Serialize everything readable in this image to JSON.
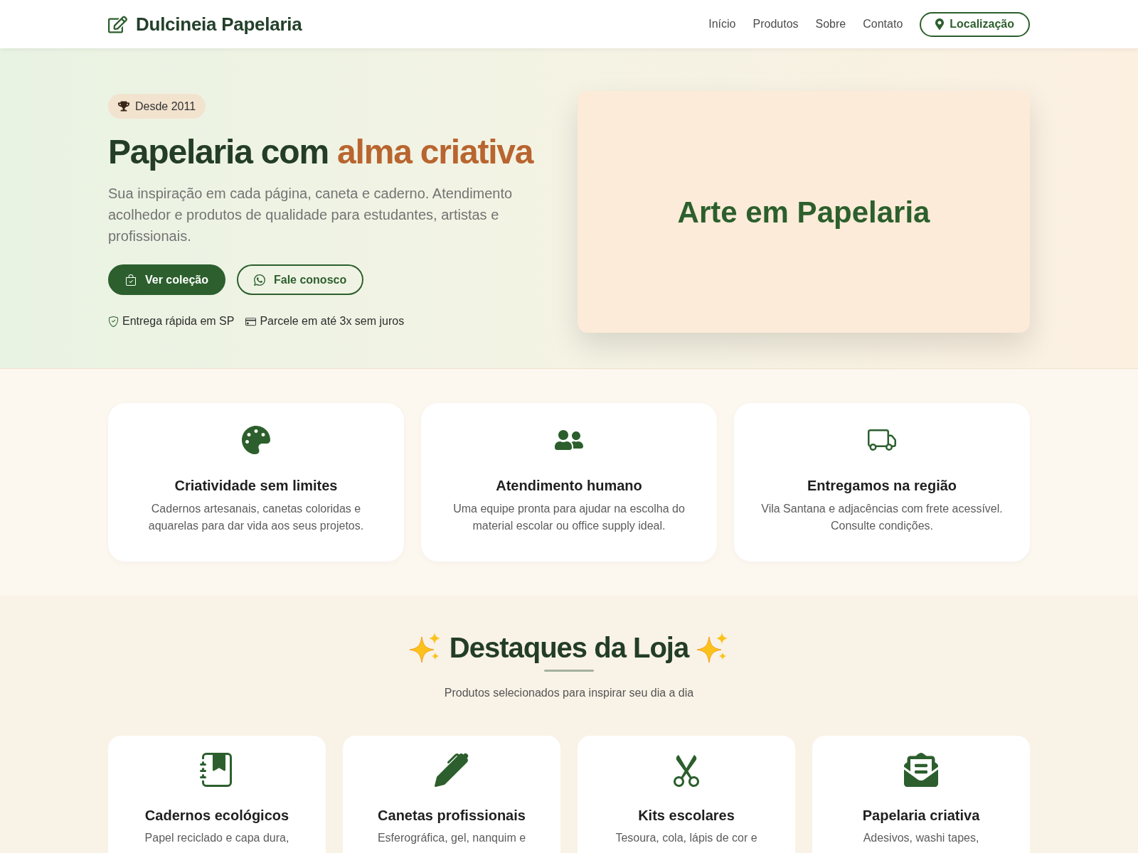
{
  "header": {
    "brand": "Dulcineia Papelaria",
    "nav": [
      "Início",
      "Produtos",
      "Sobre",
      "Contato"
    ],
    "location_button": "Localização"
  },
  "hero": {
    "badge": "Desde 2011",
    "title": "Papelaria com",
    "title_highlight": "alma criativa",
    "description": "Sua inspiração em cada página, caneta e caderno. Atendimento acolhedor e produtos de qualidade para estudantes, artistas e profissionais.",
    "buttons": [
      {
        "kind": "primary",
        "label": "Ver coleção"
      },
      {
        "kind": "outline",
        "label": "Fale conosco"
      }
    ],
    "perks": [
      "Entrega rápida em SP",
      "Parcele em até 3x sem juros"
    ],
    "showcase_text": "Arte em Papelaria"
  },
  "features": [
    {
      "title": "Criatividade sem limites",
      "description": "Cadernos artesanais, canetas coloridas e aquarelas para dar vida aos seus projetos."
    },
    {
      "title": "Atendimento humano",
      "description": "Uma equipe pronta para ajudar na escolha do material escolar ou office supply ideal."
    },
    {
      "title": "Entregamos na região",
      "description": "Vila Santana e adjacências com frete acessível. Consulte condições."
    }
  ],
  "highlights": {
    "title": "Destaques da Loja",
    "subtitle": "Produtos selecionados para inspirar seu dia a dia",
    "items": [
      {
        "title": "Cadernos ecológicos",
        "description": "Papel reciclado e capa dura,"
      },
      {
        "title": "Canetas profissionais",
        "description": "Esferográfica, gel, nanquim e"
      },
      {
        "title": "Kits escolares",
        "description": "Tesoura, cola, lápis de cor e"
      },
      {
        "title": "Papelaria criativa",
        "description": "Adesivos, washi tapes,"
      }
    ]
  }
}
